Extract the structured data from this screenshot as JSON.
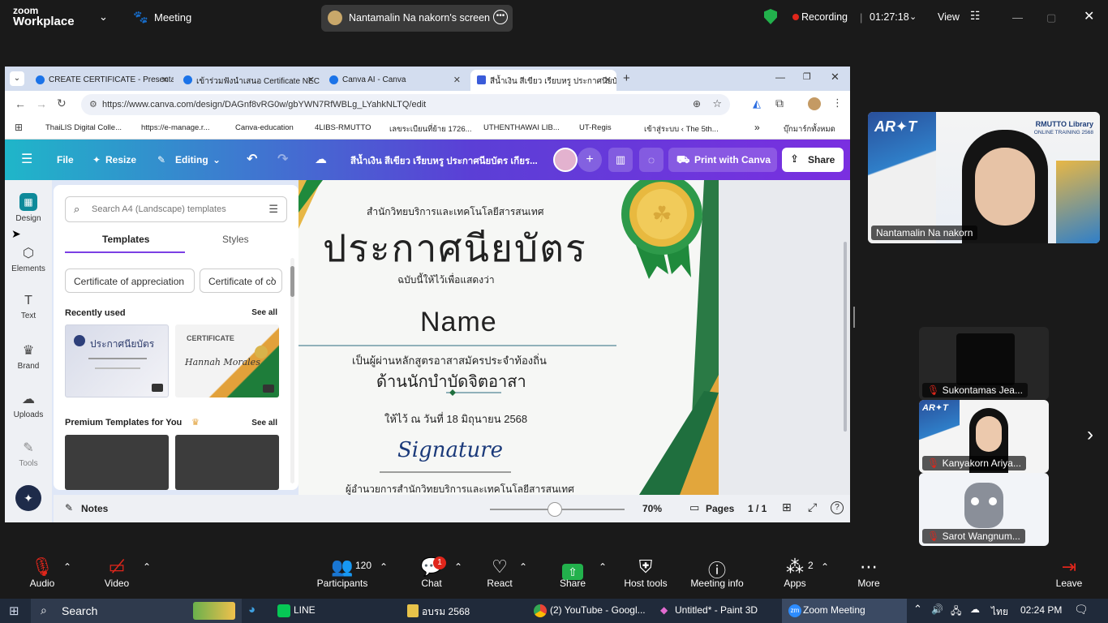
{
  "zoom": {
    "logo_line1": "zoom",
    "logo_line2": "Workplace",
    "meeting_label": "Meeting",
    "screen_share_label": "Nantamalin Na nakorn's screen",
    "recording_label": "Recording",
    "timer": "01:27:18",
    "view_label": "View"
  },
  "browser": {
    "tabs": [
      {
        "label": "CREATE CERTIFICATE - Presenta"
      },
      {
        "label": "เข้าร่วมฟังนำเสนอ Certificate NECC"
      },
      {
        "label": "Canva AI - Canva"
      },
      {
        "label": "สีน้ำเงิน สีเขียว เรียบหรู ประกาศนียบัตร"
      }
    ],
    "url": "https://www.canva.com/design/DAGnf8vRG0w/gbYWN7RfWBLg_LYahkNLTQ/edit",
    "bookmarks": [
      "ThaiLIS Digital Colle...",
      "https://e-manage.r...",
      "Canva-education",
      "4LIBS-RMUTTO",
      "เลขระเบียนที่ย้าย 1726...",
      "UTHENTHAWAI LIB...",
      "UT-Regis",
      "เข้าสู่ระบบ ‹ The 5th...",
      "บุ๊กมาร์กทั้งหมด"
    ]
  },
  "canva": {
    "menu": {
      "file": "File",
      "resize": "Resize",
      "editing": "Editing"
    },
    "doc_title": "สีน้ำเงิน สีเขียว เรียบหรู ประกาศนียบัตร เกียร...",
    "print_label": "Print with Canva",
    "share_label": "Share",
    "rail": [
      "Design",
      "Elements",
      "Text",
      "Brand",
      "Uploads",
      "Tools"
    ],
    "search_placeholder": "Search A4 (Landscape) templates",
    "panel_tabs": [
      "Templates",
      "Styles"
    ],
    "chips": [
      "Certificate of appreciation",
      "Certificate of co"
    ],
    "recently_used": "Recently used",
    "see_all": "See all",
    "premium": "Premium Templates for You",
    "thumb1_title": "ประกาศนียบัตร",
    "thumb2_title": "CERTIFICATE",
    "thumb2_sub": "Hannah Morales",
    "notes": "Notes",
    "zoom_pct": "70%",
    "pages_label": "Pages",
    "page_count": "1 / 1",
    "zoom_level": 0.48
  },
  "certificate": {
    "org": "สำนักวิทยบริการและเทคโนโลยีสารสนเทศ",
    "title": "ประกาศนียบัตร",
    "subtitle": "ฉบับนี้ให้ไว้เพื่อแสดงว่า",
    "name": "Name",
    "course": "เป็นผู้ผ่านหลักสูตรอาสาสมัครประจำท้องถิ่น",
    "role": "ด้านนักบำบัดจิตอาสา",
    "date": "ให้ไว้ ณ วันที่ 18 มิถุนายน 2568",
    "signature": "Signature",
    "signer": "ผู้อำนวยการสำนักวิทยบริการและเทคโนโลยีสารสนเทศ"
  },
  "participants": [
    {
      "name": "Nantamalin Na nakorn",
      "banner_top": "RMUTTO Library",
      "banner_sub": "ONLINE TRAINING 2568"
    },
    {
      "name": "Sukontamas Jea..."
    },
    {
      "name": "Kanyakorn Ariya..."
    },
    {
      "name": "Sarot Wangnum..."
    }
  ],
  "toolbar": {
    "audio": "Audio",
    "video": "Video",
    "participants": "Participants",
    "participants_count": "120",
    "chat": "Chat",
    "chat_badge": "1",
    "react": "React",
    "share": "Share",
    "host_tools": "Host tools",
    "meeting_info": "Meeting info",
    "apps": "Apps",
    "apps_count": "2",
    "more": "More",
    "leave": "Leave"
  },
  "taskbar": {
    "search": "Search",
    "apps": [
      "LINE",
      "อบรม 2568",
      "(2) YouTube - Googl...",
      "Untitled* - Paint 3D",
      "Zoom Meeting"
    ],
    "lang": "ไทย",
    "time": "02:24 PM"
  },
  "colors": {
    "accent": "#7b3fe4",
    "zoom_green": "#22b14c",
    "recording": "#e0261b"
  }
}
